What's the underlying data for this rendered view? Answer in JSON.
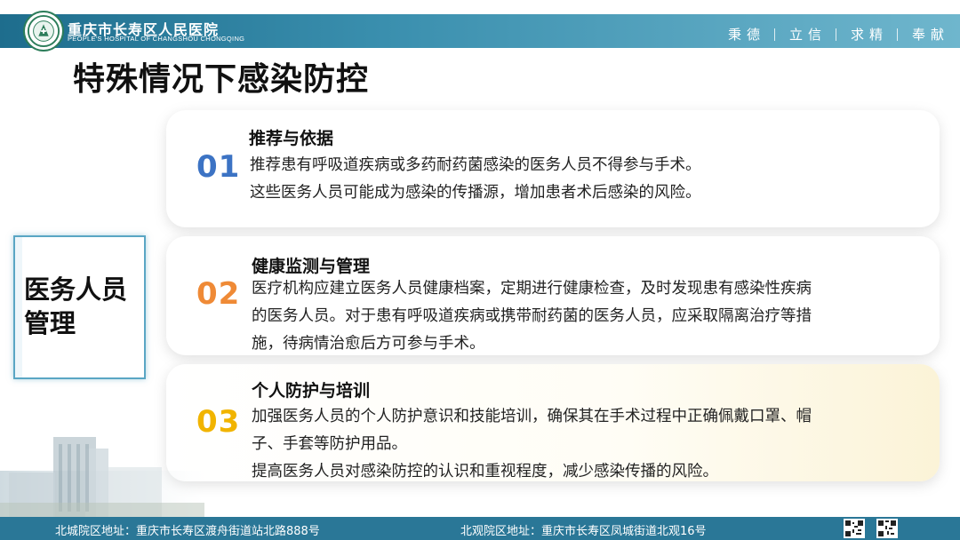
{
  "header": {
    "hospital_name": "重庆市长寿区人民医院",
    "hospital_en": "PEOPLE'S HOSPITAL OF CHANGSHOU CHONGQING",
    "motto": [
      "秉德",
      "立信",
      "求精",
      "奉献"
    ],
    "logo_icon": "hospital-logo-icon",
    "colors": {
      "bar": "#2a7797",
      "logo": "#2c7d5a"
    }
  },
  "title": "特殊情况下感染防控",
  "side_label": "医务人员管理",
  "cards": [
    {
      "num": "01",
      "num_color": "#3c73c4",
      "heading": "推荐与依据",
      "lines": [
        "推荐患有呼吸道疾病或多药耐药菌感染的医务人员不得参与手术。",
        "这些医务人员可能成为感染的传播源，增加患者术后感染的风险。"
      ]
    },
    {
      "num": "02",
      "num_color": "#ef8a36",
      "heading": "健康监测与管理",
      "lines": [
        "医疗机构应建立医务人员健康档案，定期进行健康检查，及时发现患有感染性疾病",
        "的医务人员。对于患有呼吸道疾病或携带耐药菌的医务人员，应采取隔离治疗等措",
        "施，待病情治愈后方可参与手术。"
      ]
    },
    {
      "num": "03",
      "num_color": "#f1b400",
      "heading": "个人防护与培训",
      "lines": [
        "加强医务人员的个人防护意识和技能培训，确保其在手术过程中正确佩戴口罩、帽",
        "子、手套等防护用品。",
        "提高医务人员对感染防控的认识和重视程度，减少感染传播的风险。"
      ]
    }
  ],
  "footer": {
    "north_city": "北城院区地址：重庆市长寿区渡舟街道站北路888号",
    "north_view": "北观院区地址：重庆市长寿区凤城街道北观16号",
    "qr_icons": [
      "qr-code-icon",
      "qr-code-icon"
    ]
  }
}
